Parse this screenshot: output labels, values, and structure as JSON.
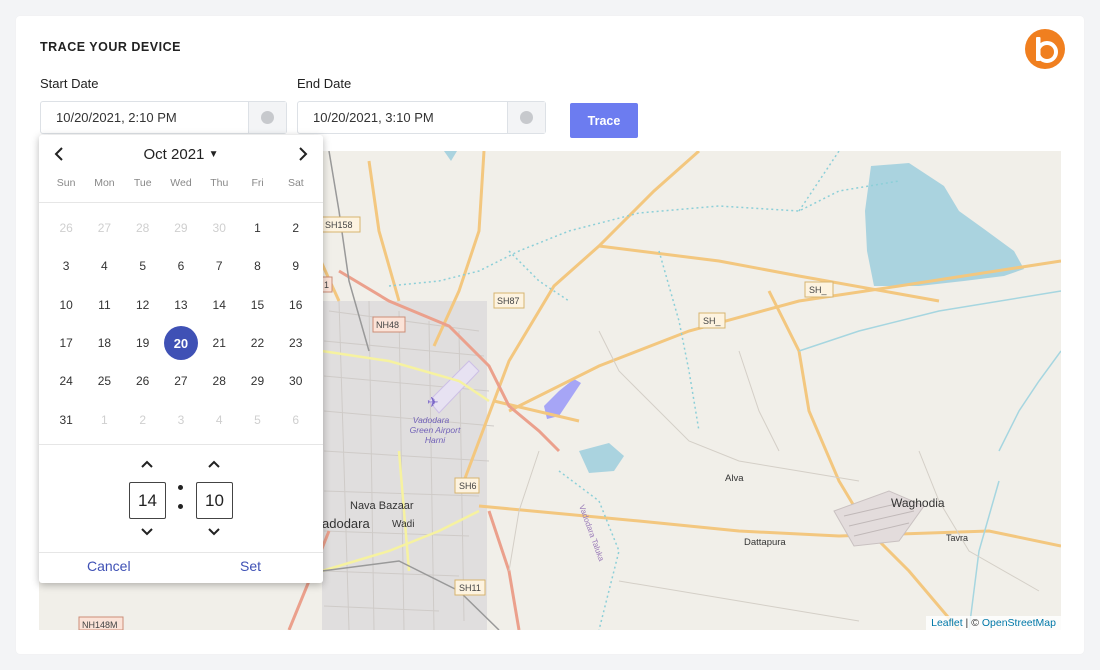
{
  "header": {
    "title": "TRACE YOUR DEVICE",
    "logo_icon": "brand-logo-icon"
  },
  "form": {
    "start_label": "Start Date",
    "start_value": "10/20/2021, 2:10 PM",
    "end_label": "End Date",
    "end_value": "10/20/2021, 3:10 PM",
    "trace_label": "Trace",
    "accent": "#6c7cf0"
  },
  "picker": {
    "month_label": "Oct 2021",
    "weekdays": [
      "Sun",
      "Mon",
      "Tue",
      "Wed",
      "Thu",
      "Fri",
      "Sat"
    ],
    "days": [
      {
        "d": "26",
        "m": true
      },
      {
        "d": "27",
        "m": true
      },
      {
        "d": "28",
        "m": true
      },
      {
        "d": "29",
        "m": true
      },
      {
        "d": "30",
        "m": true
      },
      {
        "d": "1"
      },
      {
        "d": "2"
      },
      {
        "d": "3"
      },
      {
        "d": "4"
      },
      {
        "d": "5"
      },
      {
        "d": "6"
      },
      {
        "d": "7"
      },
      {
        "d": "8"
      },
      {
        "d": "9"
      },
      {
        "d": "10"
      },
      {
        "d": "11"
      },
      {
        "d": "12"
      },
      {
        "d": "13"
      },
      {
        "d": "14"
      },
      {
        "d": "15"
      },
      {
        "d": "16"
      },
      {
        "d": "17"
      },
      {
        "d": "18"
      },
      {
        "d": "19"
      },
      {
        "d": "20",
        "s": true
      },
      {
        "d": "21"
      },
      {
        "d": "22"
      },
      {
        "d": "23"
      },
      {
        "d": "24"
      },
      {
        "d": "25"
      },
      {
        "d": "26"
      },
      {
        "d": "27"
      },
      {
        "d": "28"
      },
      {
        "d": "29"
      },
      {
        "d": "30"
      },
      {
        "d": "31"
      },
      {
        "d": "1",
        "m": true
      },
      {
        "d": "2",
        "m": true
      },
      {
        "d": "3",
        "m": true
      },
      {
        "d": "4",
        "m": true
      },
      {
        "d": "5",
        "m": true
      },
      {
        "d": "6",
        "m": true
      }
    ],
    "hour": "14",
    "minute": "10",
    "cancel_label": "Cancel",
    "set_label": "Set",
    "selected_color": "#3f51b5"
  },
  "map": {
    "labels": {
      "sh158": "SH158",
      "sh87": "SH87",
      "sh_a": "SH_",
      "sh_b": "SH_",
      "nh48": "NH48",
      "airport1": "Vadodara",
      "airport2": "Green Airport",
      "airport3": "Harni",
      "alva": "Alva",
      "waghodia": "Waghodia",
      "dattapura": "Dattapura",
      "tavra": "Tavra",
      "nava_bazaar": "Nava Bazaar",
      "vadodara": "adodara",
      "wadi": "Wadi",
      "sh6": "SH6",
      "sh11": "SH11",
      "nh148m": "NH148M",
      "taluka": "Vadodara Taluka",
      "nh1": "1"
    },
    "attribution_leaflet": "Leaflet",
    "attribution_sep": " | © ",
    "attribution_osm": "OpenStreetMap"
  }
}
